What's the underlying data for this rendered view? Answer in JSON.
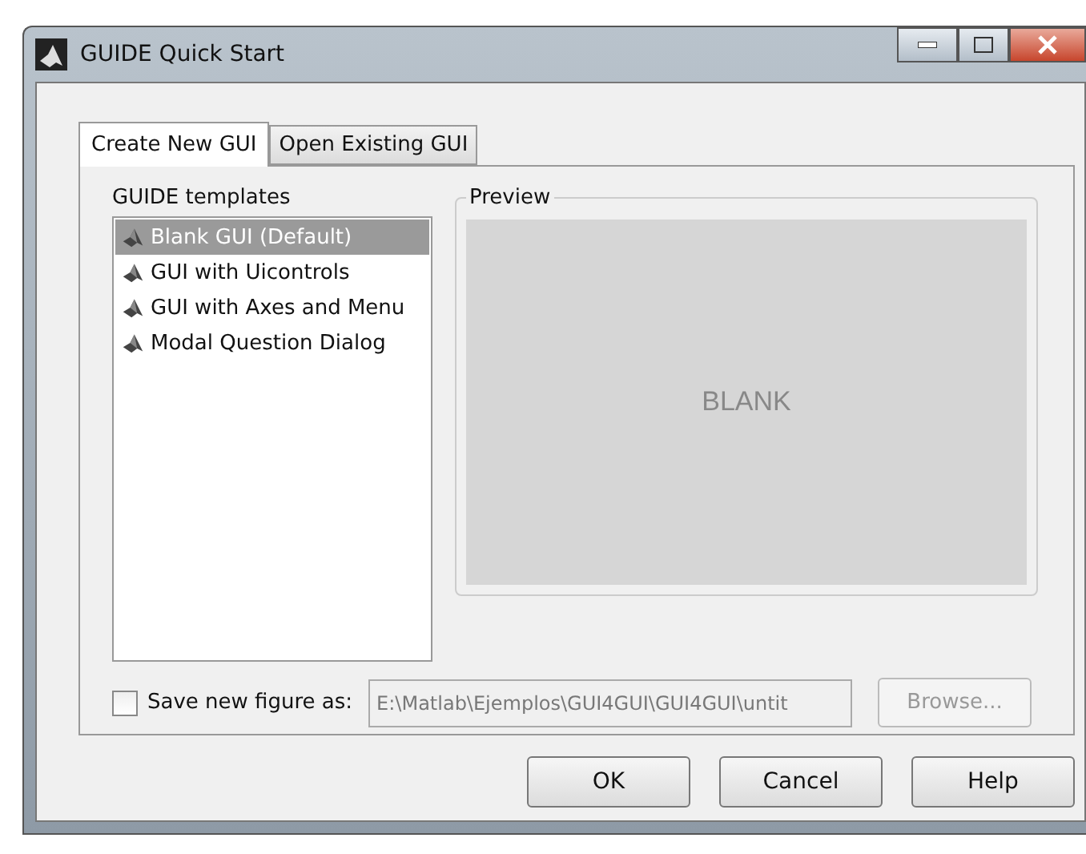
{
  "window": {
    "title": "GUIDE Quick Start"
  },
  "tabs": [
    {
      "label": "Create New GUI",
      "selected": true
    },
    {
      "label": "Open Existing GUI",
      "selected": false
    }
  ],
  "templates": {
    "label": "GUIDE templates",
    "items": [
      {
        "label": "Blank GUI (Default)",
        "selected": true
      },
      {
        "label": "GUI with Uicontrols",
        "selected": false
      },
      {
        "label": "GUI with Axes and Menu",
        "selected": false
      },
      {
        "label": "Modal Question Dialog",
        "selected": false
      }
    ]
  },
  "preview": {
    "label": "Preview",
    "text": "BLANK"
  },
  "save": {
    "label": "Save new figure as:",
    "checked": false,
    "value": "E:\\Matlab\\Ejemplos\\GUI4GUI\\GUI4GUI\\untit",
    "browse": "Browse..."
  },
  "buttons": [
    "OK",
    "Cancel",
    "Help"
  ]
}
